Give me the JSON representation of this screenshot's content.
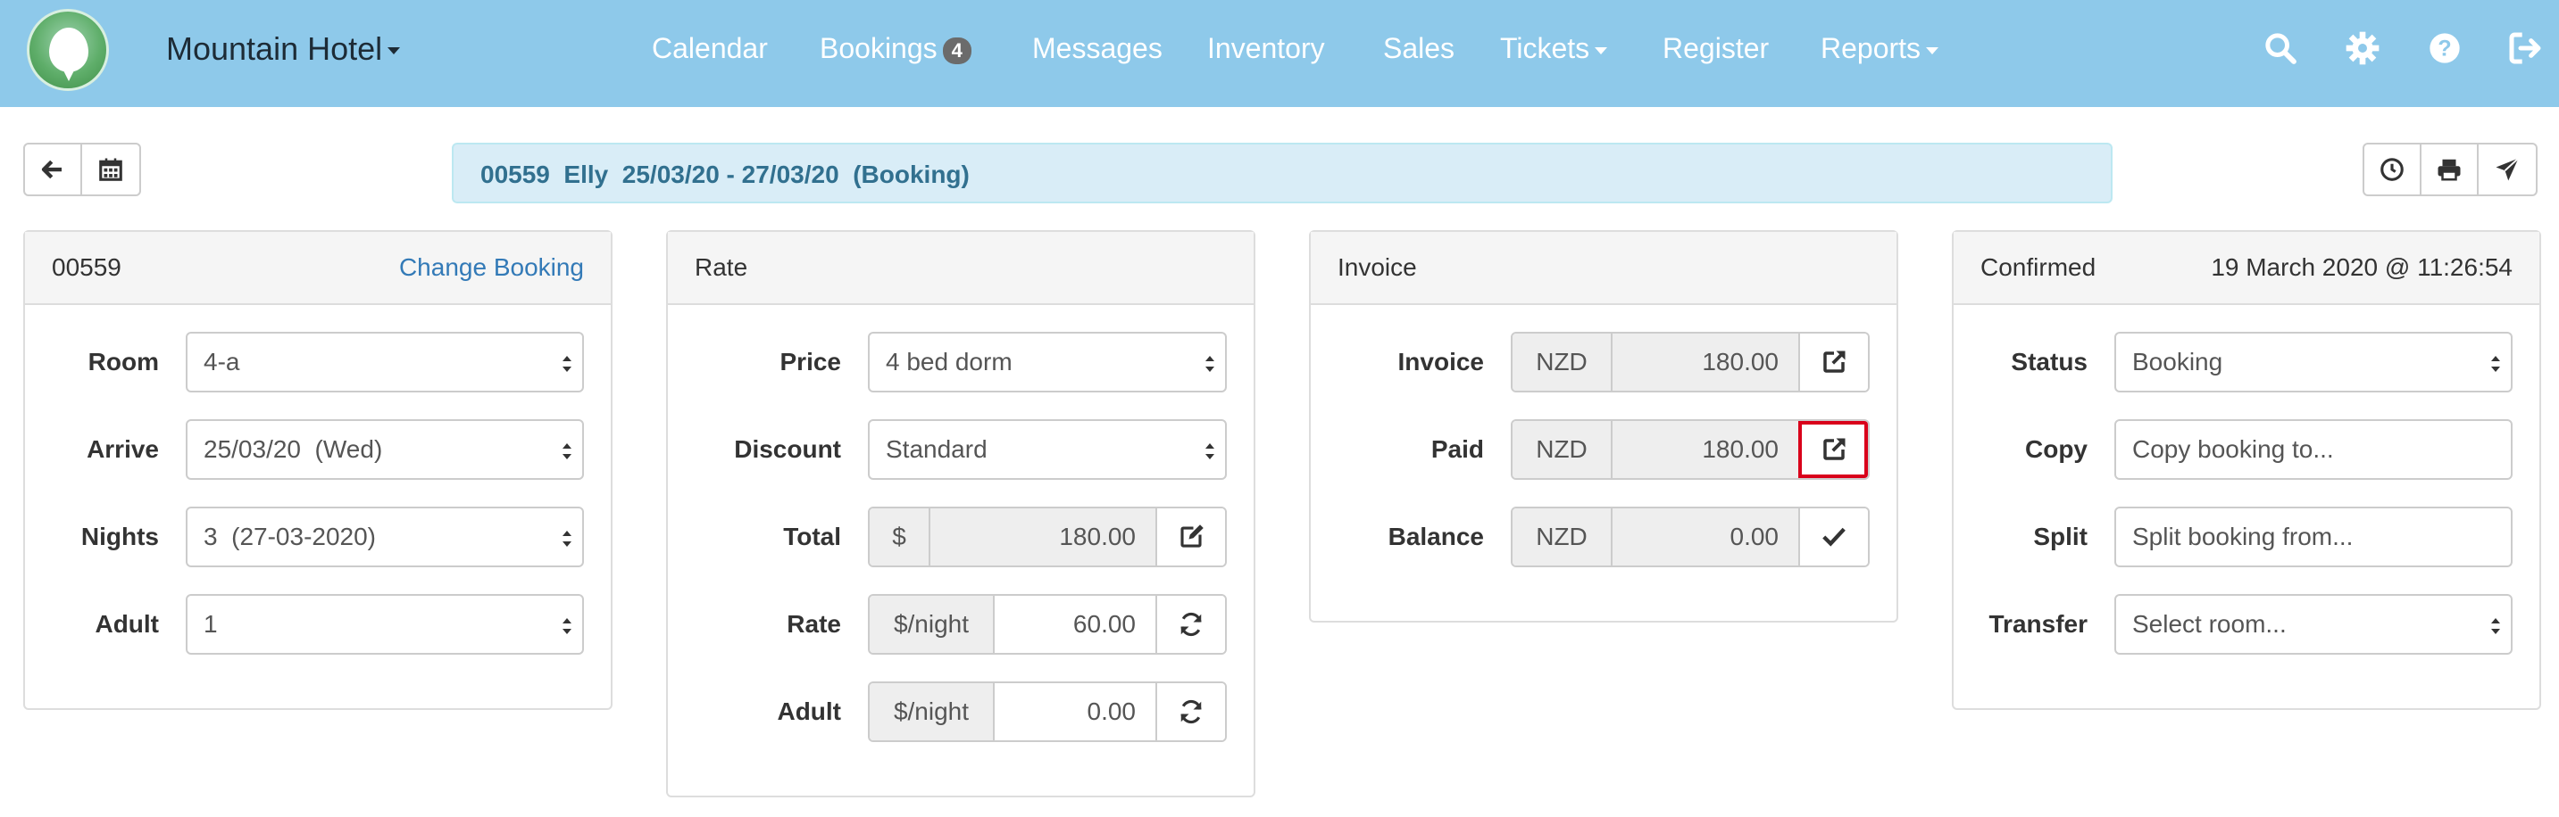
{
  "nav": {
    "hotel": "Mountain Hotel",
    "items": [
      "Calendar",
      "Bookings",
      "Messages",
      "Inventory",
      "Sales",
      "Tickets",
      "Register",
      "Reports"
    ],
    "bookings_badge": "4"
  },
  "info_bar": "00559  Elly  25/03/20 - 27/03/20  (Booking)",
  "booking_panel": {
    "id": "00559",
    "change_link": "Change Booking",
    "room_label": "Room",
    "room_value": "4-a",
    "arrive_label": "Arrive",
    "arrive_value": "25/03/20  (Wed)",
    "nights_label": "Nights",
    "nights_value": "3  (27-03-2020)",
    "adult_label": "Adult",
    "adult_value": "1"
  },
  "rate_panel": {
    "title": "Rate",
    "price_label": "Price",
    "price_value": "4 bed dorm",
    "discount_label": "Discount",
    "discount_value": "Standard",
    "total_label": "Total",
    "total_addon": "$",
    "total_value": "180.00",
    "rate_label": "Rate",
    "rate_addon": "$/night",
    "rate_value": "60.00",
    "adult_label": "Adult",
    "adult_addon": "$/night",
    "adult_value": "0.00"
  },
  "invoice_panel": {
    "title": "Invoice",
    "invoice_label": "Invoice",
    "invoice_currency": "NZD",
    "invoice_value": "180.00",
    "paid_label": "Paid",
    "paid_currency": "NZD",
    "paid_value": "180.00",
    "balance_label": "Balance",
    "balance_currency": "NZD",
    "balance_value": "0.00"
  },
  "status_panel": {
    "title": "Confirmed",
    "timestamp": "19 March 2020 @ 11:26:54",
    "status_label": "Status",
    "status_value": "Booking",
    "copy_label": "Copy",
    "copy_value": "Copy booking to...",
    "split_label": "Split",
    "split_value": "Split booking from...",
    "transfer_label": "Transfer",
    "transfer_value": "Select room..."
  }
}
